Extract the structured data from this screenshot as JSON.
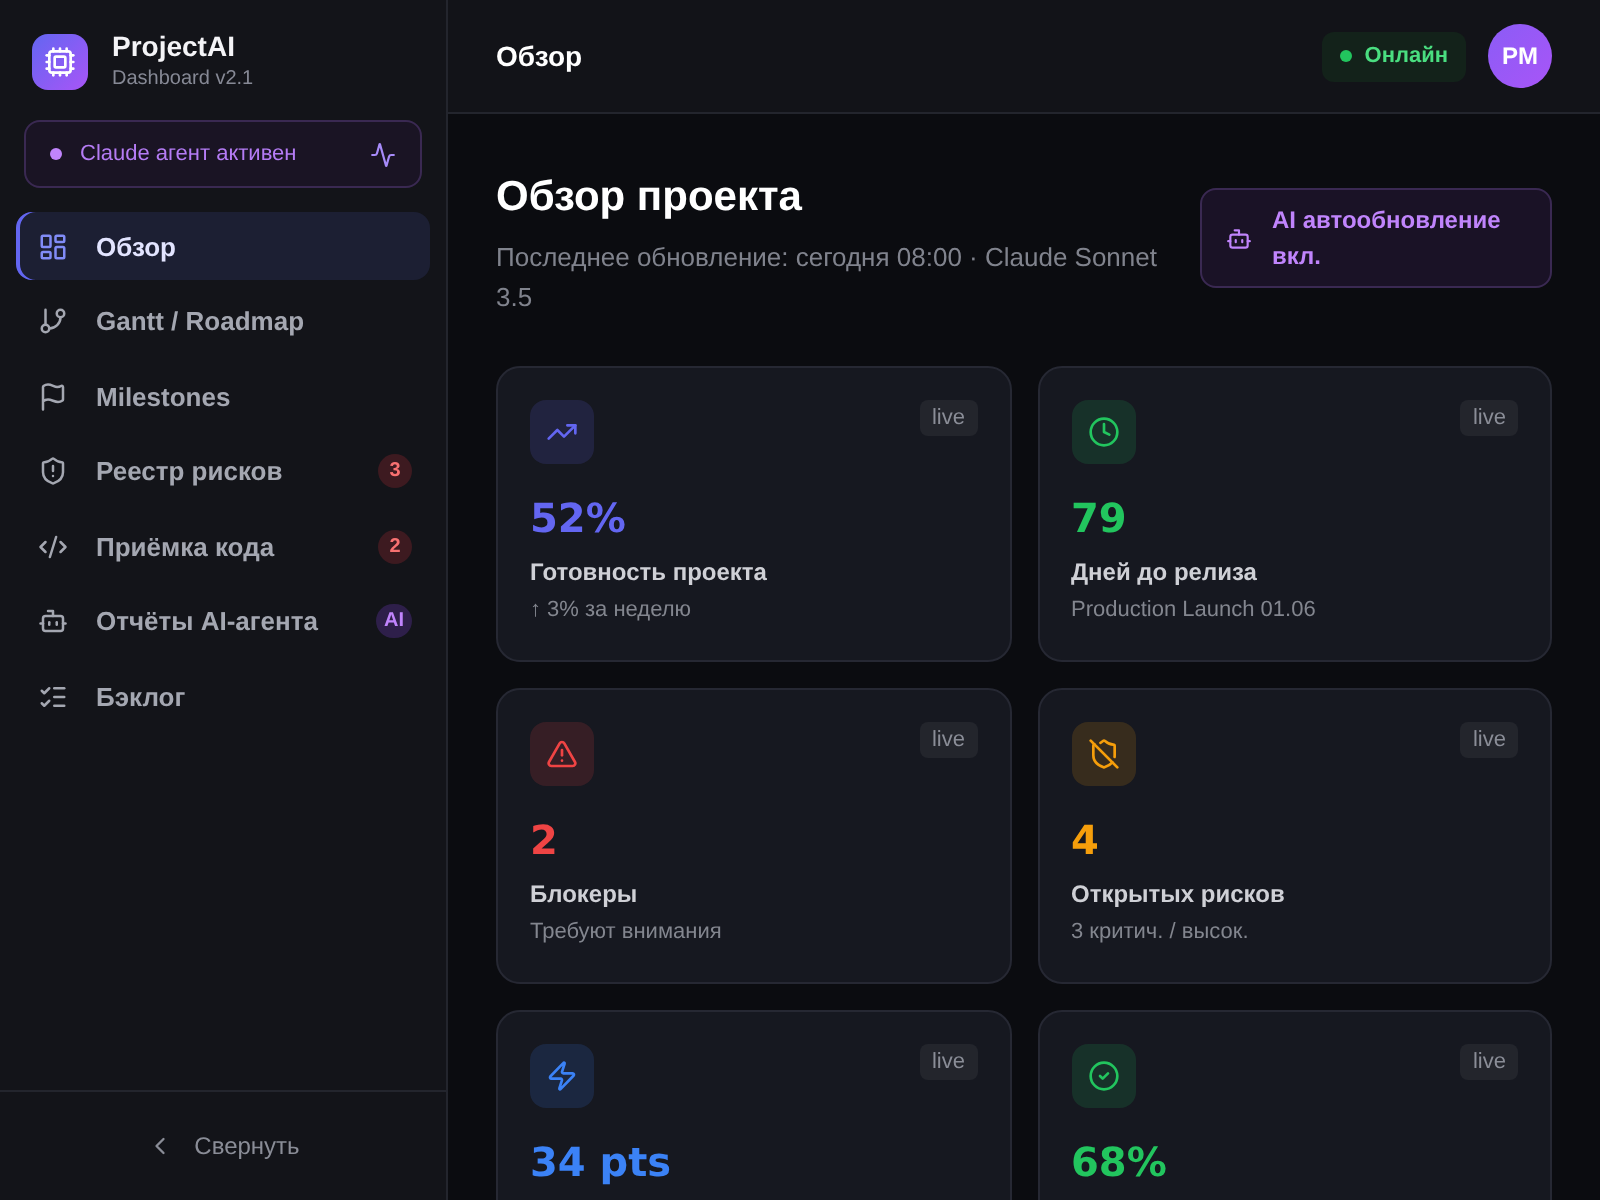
{
  "sidebar": {
    "brand": {
      "name": "ProjectAI",
      "version": "Dashboard v2.1"
    },
    "agent_status": "Claude агент активен",
    "items": [
      {
        "label": "Обзор",
        "selected": true
      },
      {
        "label": "Gantt / Roadmap",
        "selected": false
      },
      {
        "label": "Milestones",
        "selected": false
      },
      {
        "label": "Реестр рисков",
        "selected": false,
        "badge": {
          "text": "3",
          "kind": "alert"
        }
      },
      {
        "label": "Приёмка кода",
        "selected": false,
        "badge": {
          "text": "2",
          "kind": "alert"
        }
      },
      {
        "label": "Отчёты AI-агента",
        "selected": false,
        "badge": {
          "text": "AI",
          "kind": "ai"
        }
      },
      {
        "label": "Бэклог",
        "selected": false
      }
    ],
    "collapse": "Свернуть"
  },
  "header": {
    "title": "Обзор",
    "status": "Онлайн",
    "avatar": "PM"
  },
  "overview": {
    "title": "Обзор проекта",
    "subtitle": "Последнее обновление: сегодня 08:00 · Claude Sonnet 3.5",
    "ai_notice": "AI автообновление вкл."
  },
  "cards": [
    {
      "value": "52%",
      "label": "Готовность проекта",
      "note": "↑ 3% за неделю",
      "tag": "live",
      "color": "#6366f1"
    },
    {
      "value": "79",
      "label": "Дней до релиза",
      "note": "Production Launch 01.06",
      "tag": "live",
      "color": "#22c55e"
    },
    {
      "value": "2",
      "label": "Блокеры",
      "note": "Требуют внимания",
      "tag": "live",
      "color": "#ef4444"
    },
    {
      "value": "4",
      "label": "Открытых рисков",
      "note": "3 критич. / высок.",
      "tag": "live",
      "color": "#f59e0b"
    },
    {
      "value": "34 pts",
      "tag": "live",
      "color": "#3b82f6"
    },
    {
      "value": "68%",
      "tag": "live",
      "color": "#22c55e"
    }
  ]
}
